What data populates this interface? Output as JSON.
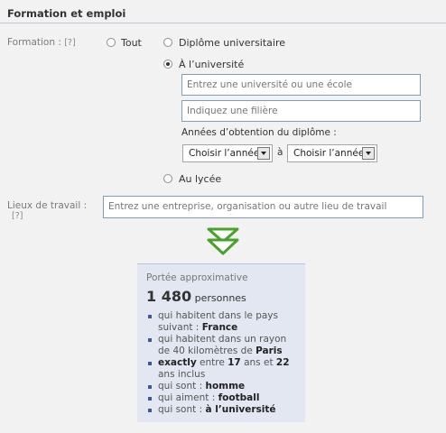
{
  "section": {
    "title": "Formation et emploi"
  },
  "formation": {
    "label": "Formation :",
    "help": "[?]",
    "options": [
      {
        "label": "Tout",
        "checked": false
      },
      {
        "label": "Diplôme universitaire",
        "checked": false
      },
      {
        "label": "À l’université",
        "checked": true
      },
      {
        "label": "Au lycée",
        "checked": false
      }
    ],
    "university_placeholder": "Entrez une université ou une école",
    "field_placeholder": "Indiquez une filière",
    "years_label": "Années d’obtention du diplôme :",
    "year_from": "Choisir l’année",
    "year_sep": "à",
    "year_to": "Choisir l’année"
  },
  "work": {
    "label": "Lieux de travail :",
    "help": "[?]",
    "placeholder": "Entrez une entreprise, organisation ou autre lieu de travail"
  },
  "icons": {
    "arrow": "double-down-arrow-icon",
    "accent": "#4aa02c"
  },
  "reach": {
    "title": "Portée approximative",
    "count": "1 480",
    "unit": "personnes",
    "criteria": [
      {
        "text": "qui habitent dans le pays suivant : ",
        "bold": "France"
      },
      {
        "text": "qui habitent dans un rayon de 40 kilomètres de ",
        "bold": "Paris"
      },
      {
        "bold_a": "exactly",
        "text_a": " entre ",
        "bold_b": "17",
        "text_b": " ans et ",
        "bold_c": "22",
        "text_c": " ans inclus"
      },
      {
        "text": "qui sont : ",
        "bold": "homme"
      },
      {
        "text": "qui aiment : ",
        "bold": "football"
      },
      {
        "text": "qui sont : ",
        "bold": "à l’université"
      }
    ]
  }
}
